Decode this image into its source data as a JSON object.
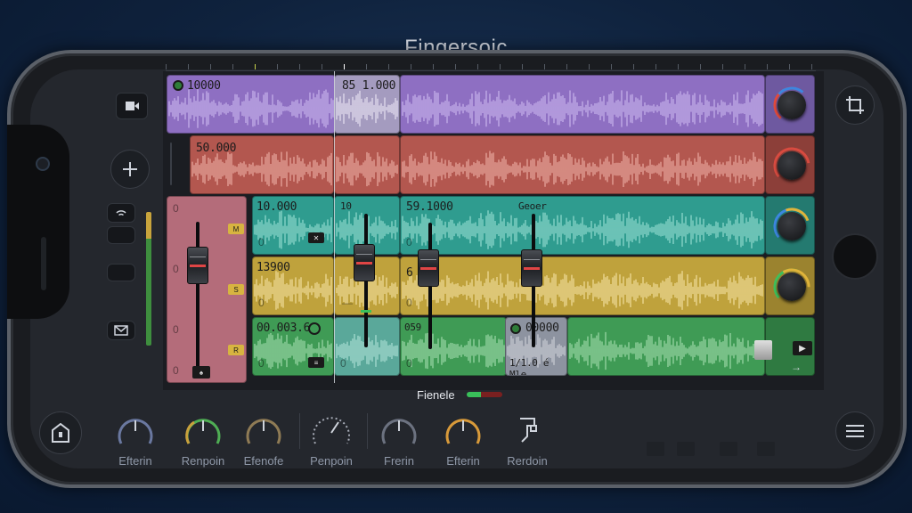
{
  "app": {
    "title": "Fingersoic"
  },
  "colors": {
    "purple": "#8e6fc2",
    "red": "#b3574f",
    "teal": "#2f9c8f",
    "yellow": "#bfa23c",
    "green": "#3f9b55",
    "pink": "#b46c7a"
  },
  "left_panel": {
    "top_icon": "film-icon",
    "add_icon": "plus-icon",
    "mic_icon": "wifi-icon",
    "mail_icon": "envelope-icon",
    "home_icon": "home-icon"
  },
  "right_panel": {
    "crop_icon": "crop-icon",
    "menu_icon": "menu-icon"
  },
  "tracks": [
    {
      "clips": [
        {
          "label": "10000"
        },
        {
          "label": "85 1.000"
        }
      ]
    },
    {
      "clips": [
        {
          "label": "50.000"
        }
      ]
    },
    {
      "clips": [
        {
          "label": "0"
        },
        {
          "label": "10.000"
        },
        {
          "label": "10"
        },
        {
          "label": "59.1000"
        },
        {
          "label": "Geoer"
        }
      ]
    },
    {
      "clips": [
        {
          "label": "13900"
        }
      ]
    },
    {
      "clips": [
        {
          "label": "00.003.6"
        },
        {
          "label": "00000"
        },
        {
          "label": "1/1.0 é Mle"
        }
      ]
    }
  ],
  "pink_channel": {
    "labels": [
      "0",
      "0",
      "0",
      "0"
    ]
  },
  "track_zeros": [
    "0",
    "0",
    "0",
    "0",
    "0",
    "0",
    "0"
  ],
  "yellow_six": "6",
  "green_059": "059",
  "status": {
    "text": "Fienele"
  },
  "dials": [
    {
      "label": "Efterin"
    },
    {
      "label": "Renpoin"
    },
    {
      "label": "Efenofe"
    },
    {
      "label": "Penpoin"
    },
    {
      "label": "Frerin"
    },
    {
      "label": "Efterin"
    },
    {
      "label": "Rerdoin"
    }
  ]
}
